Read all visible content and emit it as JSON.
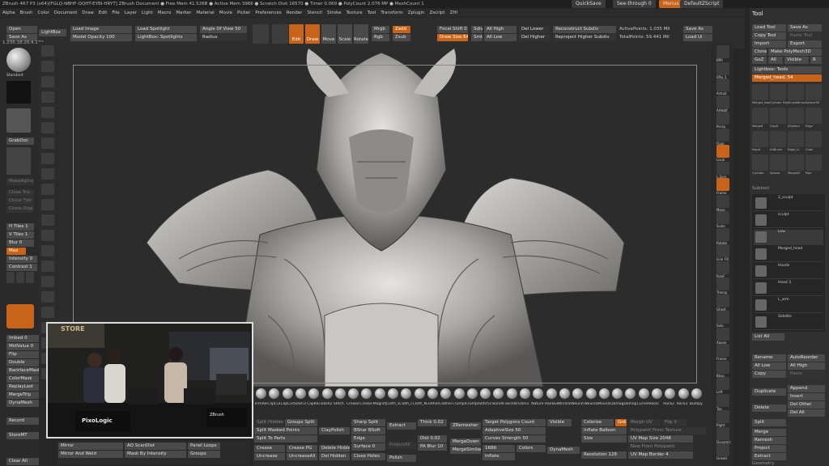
{
  "titlebar": {
    "text": "ZBrush 4R7 P3 (x64)[FGLQ-NBHF-QQHT-EYBI-HRYT]   ZBrush Document    ● Free Mem 41.526B ● Active Mem 3966 ● Scratch Disk 16570 ● Timer 0.069 ● PolyCount 2.076 MP ● MeshCount 1",
    "quicksave": "QuickSave",
    "seethrough": "See-through 0",
    "menus": "Menus",
    "defaultzscript": "DefaultZScript"
  },
  "menubar": [
    "Alpha",
    "Brush",
    "Color",
    "Document",
    "Draw",
    "Edit",
    "File",
    "Layer",
    "Light",
    "Macro",
    "Marker",
    "Material",
    "Movie",
    "Picker",
    "Preferences",
    "Render",
    "Stencil",
    "Stroke",
    "Texture",
    "Tool",
    "Transform",
    "Zplugin",
    "Zscript",
    "ZHI"
  ],
  "topshelf": {
    "open": "Open",
    "save_as": "Save As",
    "lightbox": "LightBox",
    "load_image": "Load Image",
    "model_opacity": "Model Opacity 100",
    "load_spotlight": "Load Spotlight",
    "lightbox_spotlights": "LightBox› Spotlights",
    "angle_of_view": "Angle Of View 50",
    "spotlight_radius": "Radius",
    "edit": "Edit",
    "draw": "Draw",
    "move": "Move",
    "rotate": "Rotate",
    "scale": "Scale",
    "zadd": "Zadd",
    "zsub": "Zsub",
    "mrgb": "Mrgb",
    "rgb": "Rgb",
    "m": "M",
    "focal_shift": "Focal Shift 0",
    "z_intensity": "Z Intensity 25",
    "draw_size": "Draw Size 64",
    "dynamic": "Dynamic",
    "del_lower": "Del Lower",
    "del_higher": "Del Higher",
    "reconstruct_subdiv": "Reconstruct Subdiv",
    "reproject_higher": "Reproject Higher Subdiv",
    "active_points": "ActivePoints: 1.035 Mil",
    "total_points": "TotalPoints: 59.441 Mil",
    "save_as_right": "Save As",
    "load_ui": "Load Ui",
    "all_high": "All High",
    "all_low": "All Low",
    "sdiv": "Sdiv",
    "smt": "Smt"
  },
  "left": {
    "coords": "1.235,18.20,4.172",
    "standard": "Standard",
    "dots": "Dots",
    "alpha_off": "Alpha Off",
    "texture_off": "Texture Off",
    "grabdoc": "GrabDoc",
    "make_alpha": "MakeAlpha",
    "close_tris": "Close Tris",
    "clone_txtr": "Clone Txtr",
    "clone_disp": "Clone Disp",
    "tiles_h": "H Tiles 1",
    "tiles_v": "V Tiles 1",
    "blur": "Blur 0",
    "max": "Max",
    "intensity": "Intensity 0",
    "contrast": "Contrast 1",
    "imbed": "Imbed 0",
    "midvalue": "MidValue 0",
    "flip": "Flip",
    "double": "Double",
    "backface_mask": "BackfaceMask",
    "colormask": "ColorMask",
    "replaylast": "ReplayLast",
    "mergetrip": "MergeTrip",
    "dynamesh": "DynaMesh",
    "record": "Record",
    "store_mt": "StoreMT",
    "clear_all": "Clear All",
    "intensity2": "Intensity 2"
  },
  "lefticons": [
    "Move",
    "Standard",
    "Clay",
    "ClayBuildup",
    "Dam",
    "Inflate",
    "Pinch",
    "Blob",
    "Flatten",
    "TrimDynamic",
    "hPolish",
    "Slash3",
    "Snake",
    "Curve",
    "Straight",
    "Spray",
    "MRGBZ",
    "SelectRect",
    "TrimLasso",
    "TrimRect",
    "TrimCurve",
    "Picker"
  ],
  "right_shelf": [
    "BPR",
    "SPix 3",
    "Actual",
    "AAHalf",
    "Persp",
    "Floor",
    "Local",
    "L.Sym",
    "Frame",
    "Move",
    "Scale",
    "Rotate",
    "Line Fill",
    "PolyF",
    "Transp",
    "Ghost",
    "Solo",
    "Xpose",
    "Frame",
    "Bksp",
    "Left",
    "Top",
    "Right",
    "Dynamic",
    "GrowU"
  ],
  "toolpanel": {
    "title": "Tool",
    "load_tool": "Load Tool",
    "save_as": "Save As",
    "copy_tool": "Copy Tool",
    "paste_tool": "Paste Tool",
    "import": "Import",
    "export": "Export",
    "clone": "Clone",
    "make_polymesh": "Make PolyMesh3D",
    "goz": "GoZ",
    "all": "All",
    "visible": "Visible",
    "r": "R",
    "lightbox_tools": "Lightbox› Tools",
    "merged": "Merged_head. 54",
    "thumbs": [
      "Merged_head",
      "Cylinder PolyMesh",
      "SimpleBrush",
      "Sphere3D",
      "Merged",
      "ClayB",
      "ZSphere",
      "Edge",
      "Rapid",
      "AABrush",
      "Edge_LL",
      "Cube",
      "Cylinder",
      "Sphere",
      "Merged2",
      "Pipe"
    ],
    "subtool_title": "Subtool",
    "subtools": [
      "2_sculpt",
      "sculpt",
      "Low",
      "Merged_head",
      "Hoods",
      "Head 3",
      "L_arm",
      "Sidelite"
    ],
    "list_all": "List All",
    "rename": "Rename",
    "auto_reorder": "AutoReorder",
    "all_low": "All Low",
    "all_high": "All High",
    "copy": "Copy",
    "paste": "Paste",
    "append": "Append",
    "duplicate": "Duplicate",
    "insert": "Insert",
    "del_other": "Del Other",
    "delete": "Delete",
    "del_all": "Del All",
    "split": "Split",
    "merge": "Merge",
    "remesh": "Remesh",
    "project": "Project",
    "extract": "Extract",
    "geometry": "Geometry"
  },
  "bottom": {
    "brushes": [
      "TrimRect",
      "ClipCurve",
      "ClipCircle",
      "Slash3",
      "ClipRect",
      "Slash2",
      "Stitch",
      "Crease2",
      "Crease",
      "Magnify",
      "Cloth_V",
      "Cloth_H",
      "Cloth_Mo",
      "Clothes1",
      "Clothes2",
      "Crumple",
      "CrumpleA",
      "Stitch2",
      "Skin06",
      "Skin08",
      "Dam1",
      "Nature",
      "HairBun",
      "Wrinkle",
      "Wound",
      "Wound2",
      "Wound3",
      "Damage",
      "Damage2",
      "CurveR",
      "Rock",
      "Rock2",
      "Rock3",
      "Bumpy"
    ],
    "split_hidden": "Split Hidden",
    "groups_split": "Groups Split",
    "split_masked": "Split Masked Points",
    "split_parts": "Split To Parts",
    "claypolish": "ClayPolish",
    "sharp_split": "Sharp Split",
    "bshar_bsoft": "BShar BSoft",
    "edge": "Edge",
    "surface": "Surface 0",
    "extract": "Extract",
    "project_all": "ProjectAll",
    "thick": "Thick 0.02",
    "dist": "Dist 0.02",
    "pa_blur": "PA Blur 10",
    "zremesher": "ZRemesher",
    "target_polycount": "Target Polygons Count",
    "adaptive_size": "AdaptiveSize 50",
    "curves_strength": "Curves Strength 50",
    "merge_down": "MergeDown",
    "merge_similar": "MergeSimilar",
    "visible": "Visible",
    "colorize": "Colorize",
    "grd": "Grd",
    "morph_uv": "Morph UV",
    "flip_v": "Flip V",
    "polypaint_from_texture": "Polypaint From Texture",
    "inflate_balloon": "Inflate Balloon",
    "uv_map_size": "UV Map Size 2048",
    "size": "Size",
    "new_from_polypaint": "New From Polypaint",
    "resolution": "Resolution 128",
    "uv_map_border": "UV Map Border 4",
    "dynamesh": "DynaMesh",
    "polish": "Polish",
    "blur": "Blur 2",
    "colors": "Colors",
    "inflate": "Inflate",
    "16bit": "16Bit",
    "crease": "Crease",
    "crease_pg": "Crease PG",
    "uncrease": "Uncrease",
    "uncrease_all": "UncreaseAll",
    "delete_hidden": "Delete Hidden",
    "del_hidden": "Del Hidden",
    "close_holes": "Close Holes",
    "ao_scandist": "AO ScanDist",
    "mask_by_intensity": "Mask By Intensity",
    "panel_loops": "Panel Loops",
    "groups": "Groups",
    "mirror": "Mirror",
    "mirror_and_weld": "Mirror And Weld",
    "intensity": "Intensity"
  },
  "video": {
    "logo": "PixoLogic",
    "store": "STORE",
    "zbrush": "ZBrush"
  },
  "colors": {
    "accent": "#c8641a",
    "panel": "#303030",
    "bg": "#262626"
  }
}
